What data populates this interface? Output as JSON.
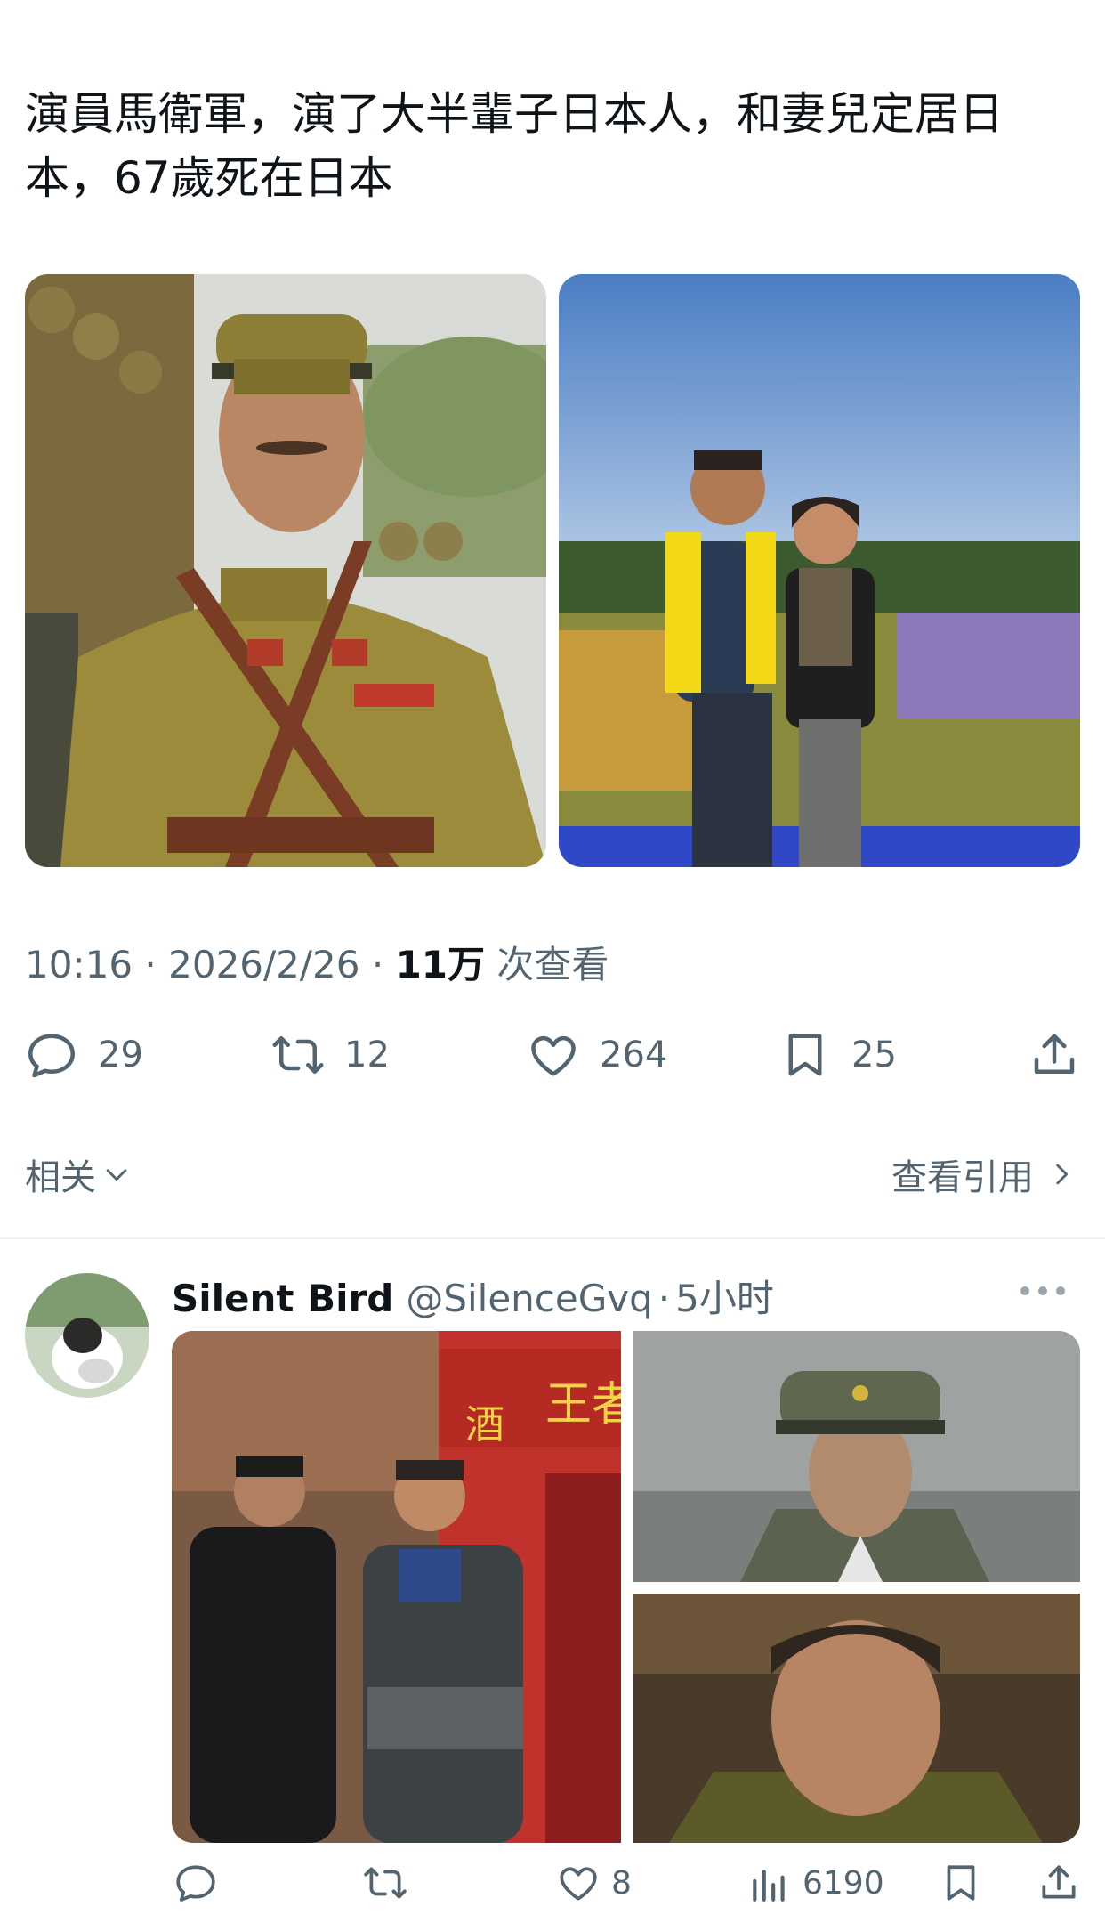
{
  "post": {
    "text": "演員馬衛軍，演了大半輩子日本人，和妻兒定居日本，67歲死在日本",
    "time": "10:16",
    "date": "2026/2/26",
    "views_count": "11万",
    "views_label": "次查看",
    "separator": "·"
  },
  "actions": {
    "reply_count": "29",
    "retweet_count": "12",
    "like_count": "264",
    "bookmark_count": "25"
  },
  "related": {
    "label": "相关",
    "view_quotes": "查看引用"
  },
  "reply": {
    "name": "Silent Bird",
    "handle": "@SilenceGvq",
    "time": "5小时",
    "separator": "·",
    "like_count": "8",
    "views_count": "6190"
  },
  "photos": {
    "sign_text_1": "王者",
    "sign_text_2": "酒"
  },
  "colors": {
    "text": "#0f1419",
    "secondary": "#536471",
    "divider": "#eff3f4"
  }
}
